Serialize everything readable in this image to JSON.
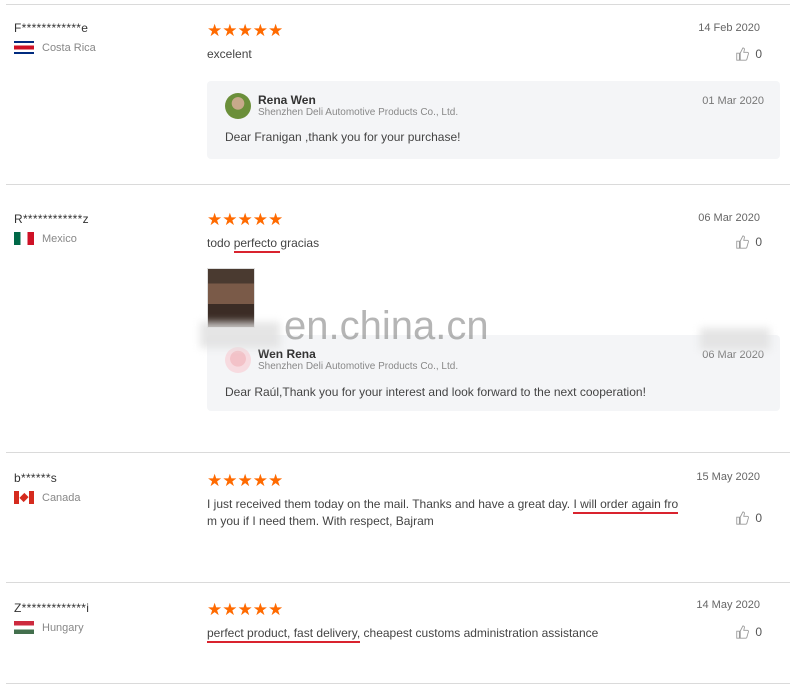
{
  "reviews": [
    {
      "user": "F************e",
      "country": "Costa Rica",
      "stars": "★★★★★",
      "date": "14 Feb 2020",
      "likes": "0",
      "text": "excelent",
      "reply": {
        "name": "Rena Wen",
        "company": "Shenzhen Deli Automotive Products Co., Ltd.",
        "date": "01 Mar 2020",
        "text": "Dear Franigan ,thank you for your purchase!"
      }
    },
    {
      "user": "R************z",
      "country": "Mexico",
      "stars": "★★★★★",
      "date": "06 Mar 2020",
      "likes": "0",
      "text_a": "todo ",
      "text_b": "perfecto ",
      "text_c": " gracias",
      "reply": {
        "name": "Wen Rena",
        "company": "Shenzhen Deli Automotive Products Co., Ltd.",
        "date": "06 Mar 2020",
        "text": "Dear Raúl,Thank you for your interest and look forward to the next cooperation!"
      }
    },
    {
      "user": "b******s",
      "country": "Canada",
      "stars": "★★★★★",
      "date": "15 May 2020",
      "likes": "0",
      "text_a": "I just received them today on the mail. Thanks and have a great day. ",
      "text_b": "I will order again fro",
      "text_c": "m you if I need them. With respect, Bajram"
    },
    {
      "user": "Z*************i",
      "country": "Hungary",
      "stars": "★★★★★",
      "date": "14 May 2020",
      "likes": "0",
      "text_a": "perfect product, fast delivery,",
      "text_b": " cheapest customs administration assistance"
    }
  ],
  "watermark": "en.china.cn",
  "colors": {
    "star": "#ff6a00",
    "underline": "#d9232e",
    "reply_bg": "#f4f5f7"
  },
  "icons": {
    "like": "thumbs-up-icon"
  }
}
